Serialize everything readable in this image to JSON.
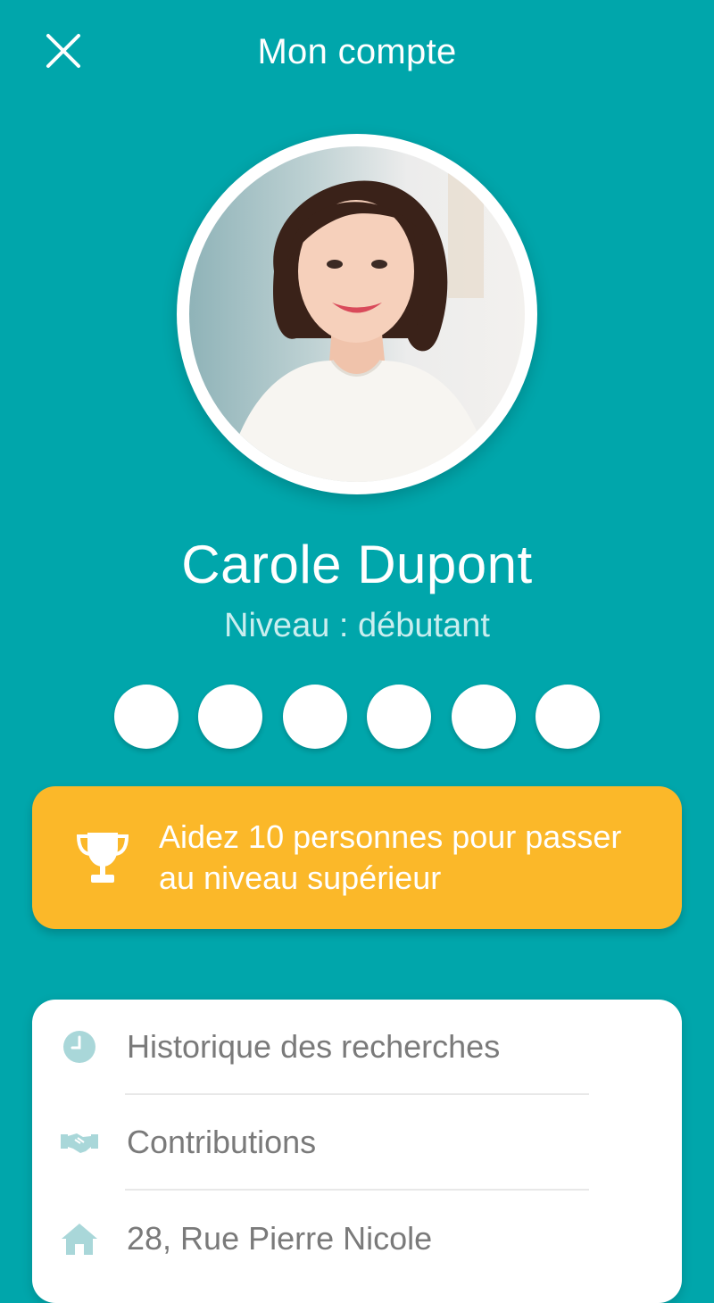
{
  "header": {
    "title": "Mon compte",
    "close_icon": "close-icon"
  },
  "profile": {
    "name": "Carole Dupont",
    "level_text": "Niveau : débutant",
    "avatar": "profile-photo",
    "level_dots_count": 6
  },
  "banner": {
    "icon": "trophy-icon",
    "text_line1": "Aidez 10 personnes pour passer",
    "text_line2": "au niveau supérieur"
  },
  "menu": {
    "items": [
      {
        "icon": "clock-icon",
        "label": "Historique des recherches"
      },
      {
        "icon": "handshake-icon",
        "label": "Contributions"
      },
      {
        "icon": "home-icon",
        "label": "28, Rue Pierre Nicole"
      }
    ]
  },
  "colors": {
    "background": "#00a6ab",
    "banner": "#fbb829",
    "icon_tint": "#a9d7d9",
    "menu_text": "#7a7a7a"
  }
}
